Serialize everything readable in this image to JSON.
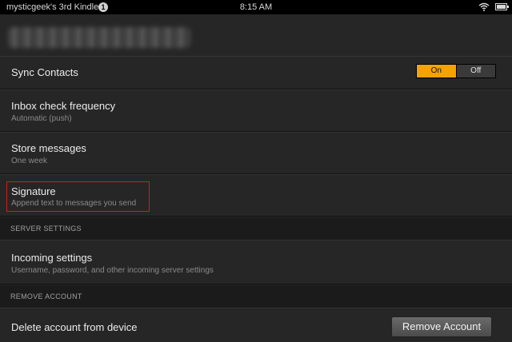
{
  "status_bar": {
    "device_name": "mysticgeek's 3rd Kindle",
    "notification_count": "1",
    "time": "8:15 AM",
    "wifi_icon": "wifi-icon",
    "battery_icon": "battery-icon"
  },
  "account": {
    "email_redacted": true
  },
  "settings": {
    "sync_contacts": {
      "label": "Sync Contacts",
      "toggle_on": "On",
      "toggle_off": "Off",
      "selected": "On"
    },
    "inbox_check": {
      "label": "Inbox check frequency",
      "value": "Automatic (push)"
    },
    "store_messages": {
      "label": "Store messages",
      "value": "One week"
    },
    "signature": {
      "label": "Signature",
      "description": "Append text to messages you send"
    }
  },
  "server_settings": {
    "header": "SERVER SETTINGS",
    "incoming": {
      "label": "Incoming settings",
      "description": "Username, password, and other incoming server settings"
    }
  },
  "remove_account": {
    "header": "REMOVE ACCOUNT",
    "label": "Delete account from device",
    "button": "Remove Account"
  },
  "colors": {
    "accent_on": "#f4a300",
    "highlight_border": "#d21b1b",
    "background": "#262626"
  }
}
